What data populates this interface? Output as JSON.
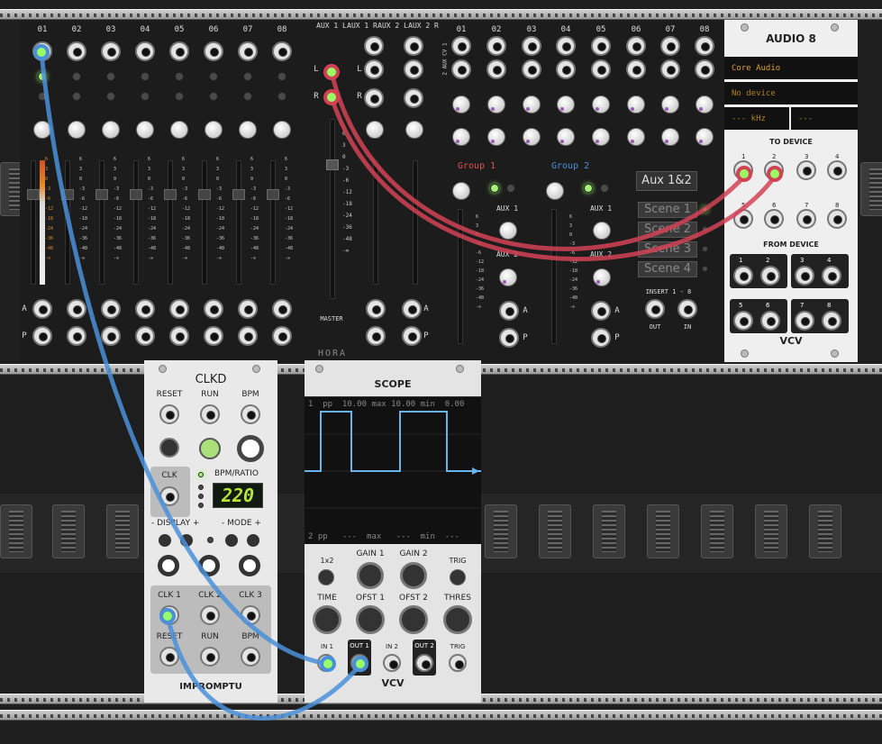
{
  "mixer": {
    "channels": [
      "01",
      "02",
      "03",
      "04",
      "05",
      "06",
      "07",
      "08"
    ],
    "aux_headers": [
      "AUX 1 L",
      "AUX 1 R",
      "AUX 2 L",
      "AUX 2 R"
    ],
    "aux_channels": [
      "01",
      "02",
      "03",
      "04",
      "05",
      "06",
      "07",
      "08"
    ],
    "stereo_label": "2 AUX CV 1",
    "lr": [
      "L",
      "R",
      "L",
      "R"
    ],
    "vu_scale": [
      "6",
      "3",
      "0",
      "-3",
      "-6",
      "-12",
      "-18",
      "-24",
      "-36",
      "-48",
      "-∞"
    ],
    "master_label": "MASTER",
    "brand": "HORA",
    "group1": "Group 1",
    "group2": "Group 2",
    "aux1": "AUX 1",
    "aux2": "AUX 2",
    "ap": [
      "A",
      "P"
    ],
    "aux12": "Aux 1&2",
    "scenes": [
      "Scene 1",
      "Scene 2",
      "Scene 3",
      "Scene 4"
    ],
    "insert": "INSERT 1 - 8",
    "out": "OUT",
    "in": "IN",
    "colors": {
      "red": "#d24255",
      "blue": "#4a90d9",
      "purple": "#9b59b6",
      "green": "#9f6"
    }
  },
  "audio8": {
    "title": "AUDIO 8",
    "driver": "Core Audio",
    "device": "No device",
    "rate": "--- kHz",
    "buf": "---",
    "to_device": "TO DEVICE",
    "from_device": "FROM DEVICE",
    "pairs": [
      "1",
      "2",
      "3",
      "4",
      "5",
      "6",
      "7",
      "8"
    ],
    "brand": "VCV"
  },
  "clkd": {
    "title": "CLKD",
    "reset": "RESET",
    "run": "RUN",
    "bpm": "BPM",
    "clk": "CLK",
    "bpm_ratio": "BPM/RATIO",
    "display_value": "220",
    "display": "- DISPLAY +",
    "mode": "- MODE +",
    "clk1": "CLK 1",
    "clk2": "CLK 2",
    "clk3": "CLK 3",
    "brand": "IMPROMPTU"
  },
  "scope": {
    "title": "SCOPE",
    "ch1": "1  pp  10.00 max 10.00 min  0.00",
    "ch2": "2 pp   ---  max   ---  min  ---",
    "k1x2": "1x2",
    "gain1": "GAIN 1",
    "gain2": "GAIN 2",
    "trig": "TRIG",
    "time": "TIME",
    "ofst1": "OFST 1",
    "ofst2": "OFST 2",
    "thres": "THRES",
    "in1": "IN 1",
    "out1": "OUT 1",
    "in2": "IN 2",
    "out2": "OUT 2",
    "trig_in": "TRIG",
    "brand": "VCV"
  }
}
